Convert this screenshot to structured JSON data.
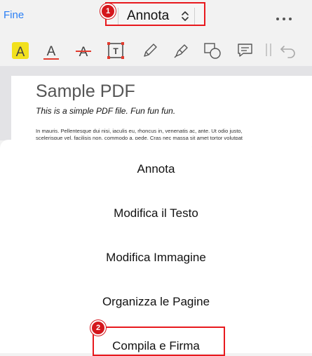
{
  "header": {
    "done_label": "Fine",
    "mode_label": "Annota",
    "badge_1": "1",
    "badge_2": "2"
  },
  "toolbar": {
    "icons": [
      "highlight-text-icon",
      "underline-text-icon",
      "strikethrough-text-icon",
      "text-box-icon",
      "pen-icon",
      "highlighter-icon",
      "shapes-icon",
      "comment-icon",
      "undo-icon"
    ]
  },
  "document": {
    "title": "Sample PDF",
    "subtitle": "This is a simple PDF file. Fun fun fun.",
    "body_line_1": "In mauris. Pellentesque dui nisi, iaculis eu, rhoncus in, venenatis ac, ante. Ut odio justo,",
    "body_line_2": "scelerisque vel, facilisis non, commodo a, pede. Cras nec massa sit amet tortor volutpat"
  },
  "menu": {
    "items": [
      "Annota",
      "Modifica il Testo",
      "Modifica Immagine",
      "Organizza le Pagine",
      "Compila e Firma"
    ]
  },
  "colors": {
    "accent": "#2a7ff5",
    "highlight_box": "#e8191e",
    "badge": "#d4161c",
    "highlight_yellow": "#f2e11d",
    "underline_red": "#e23b2e"
  }
}
